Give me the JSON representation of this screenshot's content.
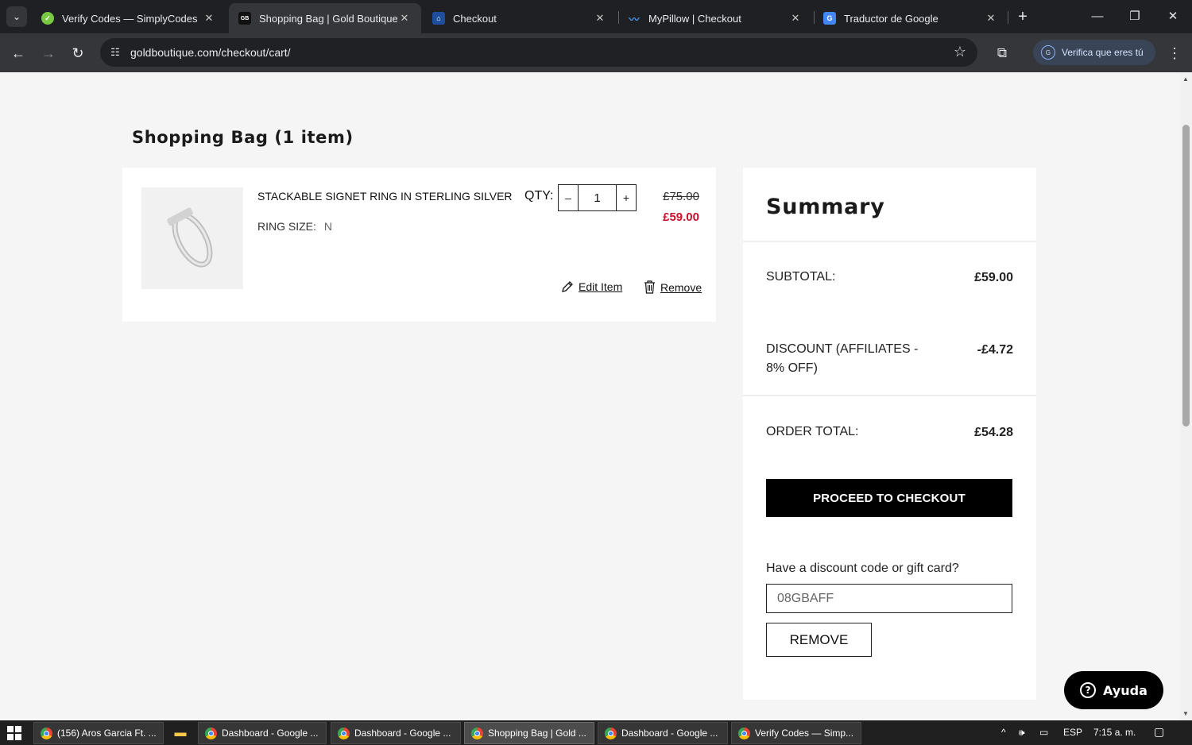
{
  "browser": {
    "tabs": [
      {
        "title": "Verify Codes — SimplyCodes",
        "active": false
      },
      {
        "title": "Shopping Bag | Gold Boutique",
        "active": true
      },
      {
        "title": "Checkout",
        "active": false
      },
      {
        "title": "MyPillow | Checkout",
        "active": false
      },
      {
        "title": "Traductor de Google",
        "active": false
      }
    ],
    "url": "goldboutique.com/checkout/cart/",
    "profile_button": "Verifica que eres tú",
    "favicon_gb": "GB",
    "favicon_g": "G"
  },
  "cart": {
    "title": "Shopping Bag (1 item)",
    "item": {
      "name": "STACKABLE SIGNET RING IN STERLING SILVER",
      "size_label": "RING SIZE:",
      "size_value": "N",
      "qty_label": "QTY:",
      "qty": "1",
      "minus": "–",
      "plus": "+",
      "price_original": "£75.00",
      "price_sale": "£59.00",
      "edit_label": "Edit Item",
      "remove_label": "Remove"
    }
  },
  "summary": {
    "title": "Summary",
    "subtotal_label": "SUBTOTAL:",
    "subtotal_value": "£59.00",
    "discount_label": "DISCOUNT (AFFILIATES - 8% OFF)",
    "discount_value": "-£4.72",
    "total_label": "ORDER TOTAL:",
    "total_value": "£54.28",
    "checkout_button": "PROCEED TO CHECKOUT",
    "code_question": "Have a discount code or gift card?",
    "code_value": "08GBAFF",
    "remove_code_button": "REMOVE"
  },
  "help": {
    "label": "Ayuda"
  },
  "taskbar": {
    "items": [
      {
        "label": "(156) Aros Garcia Ft. ...",
        "active": false
      },
      {
        "label": "Dashboard - Google ...",
        "active": false
      },
      {
        "label": "Dashboard - Google ...",
        "active": false
      },
      {
        "label": "Shopping Bag | Gold ...",
        "active": true
      },
      {
        "label": "Dashboard - Google ...",
        "active": false
      },
      {
        "label": "Verify Codes — Simp...",
        "active": false
      }
    ],
    "language": "ESP",
    "time": "7:15 a. m."
  },
  "colors": {
    "sale_price": "#c8102e",
    "checkout_button_bg": "#000000",
    "chrome_dark": "#35363a"
  }
}
